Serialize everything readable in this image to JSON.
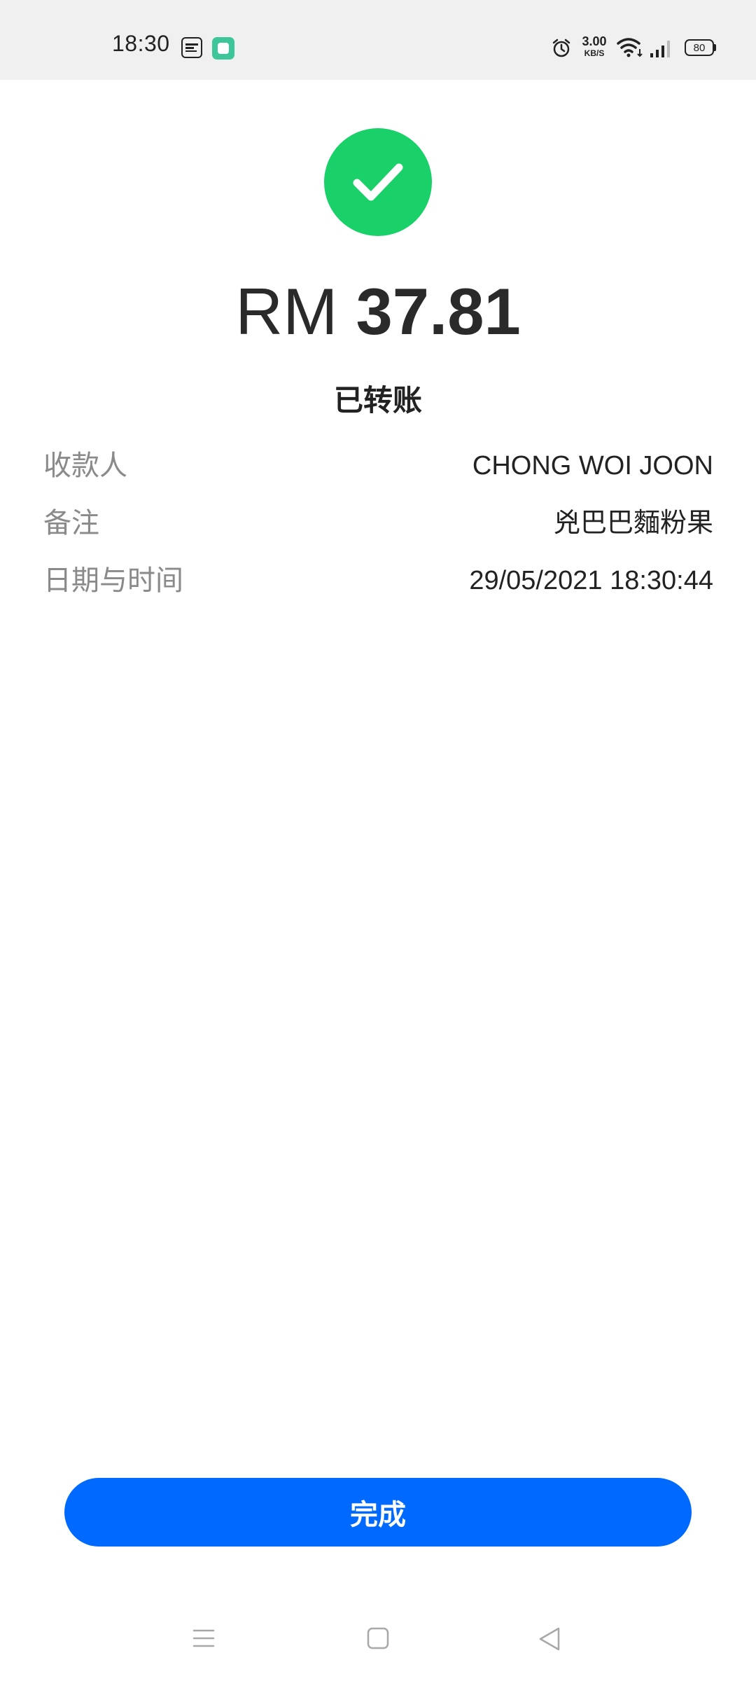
{
  "status_bar": {
    "time": "18:30",
    "net_speed_value": "3.00",
    "net_speed_unit": "KB/S",
    "battery_level": "80",
    "icons": [
      "touch-n-go-icon",
      "green-app-icon",
      "alarm-icon",
      "wifi-icon",
      "signal-icon",
      "battery-icon"
    ]
  },
  "receipt": {
    "currency": "RM",
    "amount": "37.81",
    "status": "已转账",
    "details": [
      {
        "label": "收款人",
        "value": "CHONG WOI JOON"
      },
      {
        "label": "备注",
        "value": "兇巴巴麵粉果"
      },
      {
        "label": "日期与时间",
        "value": "29/05/2021 18:30:44"
      }
    ]
  },
  "actions": {
    "done_label": "完成"
  },
  "colors": {
    "success": "#19d168",
    "primary": "#0069ff",
    "status_bar_bg": "#f0f0f0"
  },
  "nav": {
    "icons": [
      "menu-icon",
      "home-icon",
      "back-icon"
    ]
  }
}
